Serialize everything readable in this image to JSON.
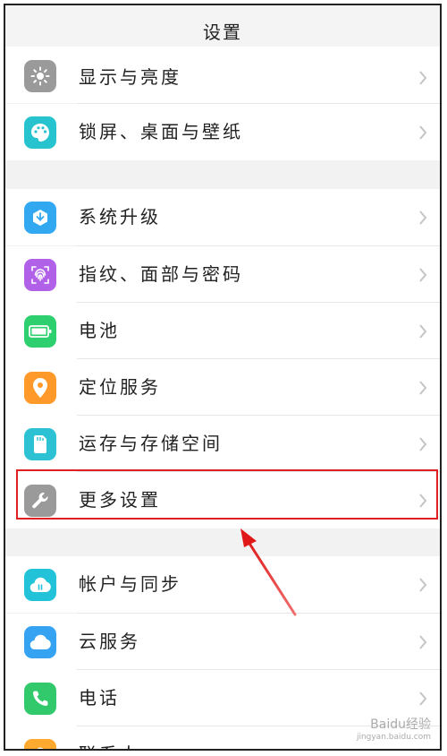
{
  "header": {
    "title": "设置"
  },
  "rows": [
    {
      "label": "显示与亮度"
    },
    {
      "label": "锁屏、桌面与壁纸"
    },
    {
      "label": "系统升级"
    },
    {
      "label": "指纹、面部与密码"
    },
    {
      "label": "电池"
    },
    {
      "label": "定位服务"
    },
    {
      "label": "运存与存储空间"
    },
    {
      "label": "更多设置"
    },
    {
      "label": "帐户与同步"
    },
    {
      "label": "云服务"
    },
    {
      "label": "电话"
    },
    {
      "label": "联系人"
    }
  ],
  "icons": [
    "sun-icon",
    "palette-icon",
    "system-update-icon",
    "fingerprint-icon",
    "battery-icon",
    "location-pin-icon",
    "sd-card-icon",
    "wrench-icon",
    "sync-cloud-icon",
    "cloud-icon",
    "phone-icon",
    "contacts-icon"
  ],
  "colors": {
    "display": "#9a9a9a",
    "wallpaper": "#27c4cf",
    "update": "#31a8f0",
    "fingerprint": "#b160e8",
    "battery": "#2ecf6e",
    "location": "#ff9a2a",
    "storage": "#2cc2d3",
    "more": "#9a9a9a",
    "account": "#22c3d8",
    "cloud": "#36a3f2",
    "phone": "#31c96b",
    "contacts": "#ffa92e",
    "highlight": "#e02020"
  },
  "watermark": {
    "text": "Baidu经验",
    "sub": "jingyan.baidu.com"
  }
}
